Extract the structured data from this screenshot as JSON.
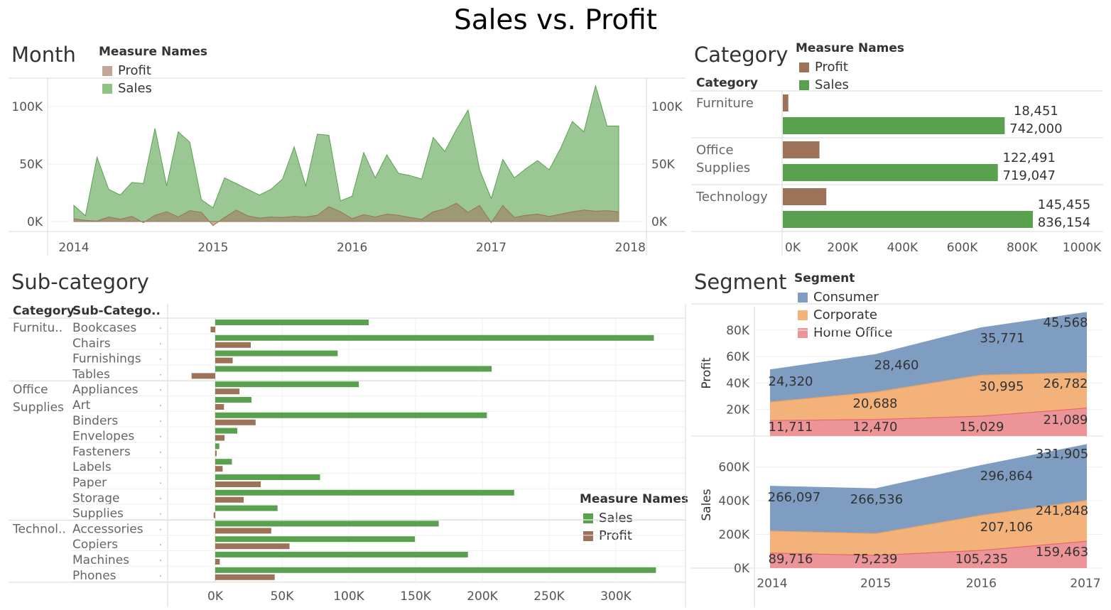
{
  "dashboard": {
    "title": "Sales vs. Profit"
  },
  "colors": {
    "sales": "#59A14F",
    "profit": "#9C7259",
    "consumer": "#7E9DC1",
    "corporate": "#F3B27A",
    "home_office": "#EC9497"
  },
  "month": {
    "title": "Month",
    "legend": {
      "title": "Measure Names",
      "items": [
        "Profit",
        "Sales"
      ]
    }
  },
  "category": {
    "title": "Category",
    "header": "Category",
    "legend": {
      "title": "Measure Names",
      "items": [
        "Profit",
        "Sales"
      ]
    }
  },
  "subcategory": {
    "title": "Sub-category",
    "headers": [
      "Category",
      "Sub-Catego.."
    ],
    "legend": {
      "title": "Measure Names",
      "items": [
        "Sales",
        "Profit"
      ]
    }
  },
  "segment": {
    "title": "Segment",
    "legend": {
      "title": "Segment",
      "items": [
        "Consumer",
        "Corporate",
        "Home Office"
      ]
    }
  },
  "chart_data": [
    {
      "id": "month",
      "type": "area",
      "x_ticks": [
        "2014",
        "2015",
        "2016",
        "2017",
        "2018"
      ],
      "y_ticks": [
        "100K",
        "50K",
        "0K"
      ],
      "ylim": [
        -5000,
        125000
      ],
      "x": [
        "2014-01",
        "2014-02",
        "2014-03",
        "2014-04",
        "2014-05",
        "2014-06",
        "2014-07",
        "2014-08",
        "2014-09",
        "2014-10",
        "2014-11",
        "2014-12",
        "2015-01",
        "2015-02",
        "2015-03",
        "2015-04",
        "2015-05",
        "2015-06",
        "2015-07",
        "2015-08",
        "2015-09",
        "2015-10",
        "2015-11",
        "2015-12",
        "2016-01",
        "2016-02",
        "2016-03",
        "2016-04",
        "2016-05",
        "2016-06",
        "2016-07",
        "2016-08",
        "2016-09",
        "2016-10",
        "2016-11",
        "2016-12",
        "2017-01",
        "2017-02",
        "2017-03",
        "2017-04",
        "2017-05",
        "2017-06",
        "2017-07",
        "2017-08",
        "2017-09",
        "2017-10",
        "2017-11",
        "2017-12"
      ],
      "series": [
        {
          "name": "Sales",
          "values": [
            14000,
            5000,
            56000,
            28000,
            23000,
            34000,
            33000,
            81000,
            31000,
            78000,
            69000,
            19000,
            12000,
            38000,
            33000,
            28000,
            23000,
            28000,
            37000,
            65000,
            31000,
            76000,
            75000,
            18000,
            22000,
            60000,
            38000,
            58000,
            42000,
            40000,
            37000,
            73000,
            61000,
            80000,
            97000,
            45000,
            20000,
            54000,
            38000,
            46000,
            53000,
            45000,
            64000,
            87000,
            78000,
            118000,
            83000,
            83000
          ]
        },
        {
          "name": "Profit",
          "values": [
            2500,
            1000,
            500,
            4000,
            2000,
            4500,
            -1000,
            5500,
            8500,
            4000,
            9500,
            8000,
            -3500,
            3500,
            10000,
            5000,
            3000,
            4000,
            3500,
            4500,
            4000,
            5500,
            13000,
            8500,
            2500,
            6000,
            4000,
            6500,
            5500,
            3500,
            2000,
            8500,
            11000,
            16000,
            8000,
            14000,
            -1000,
            14000,
            3500,
            5500,
            6500,
            4500,
            6500,
            8500,
            10000,
            9000,
            9500,
            8500
          ]
        }
      ]
    },
    {
      "id": "category",
      "type": "bar",
      "orientation": "horizontal",
      "categories": [
        "Furniture",
        "Office Supplies",
        "Technology"
      ],
      "category_lines": [
        [
          "Furniture"
        ],
        [
          "Office",
          "Supplies"
        ],
        [
          "Technology"
        ]
      ],
      "series": [
        {
          "name": "Profit",
          "values": [
            18451,
            122491,
            145455
          ],
          "labels": [
            "18,451",
            "122,491",
            "145,455"
          ]
        },
        {
          "name": "Sales",
          "values": [
            742000,
            719047,
            836154
          ],
          "labels": [
            "742,000",
            "719,047",
            "836,154"
          ]
        }
      ],
      "x_ticks": [
        "0K",
        "200K",
        "400K",
        "600K",
        "800K",
        "1000K"
      ],
      "xlim": [
        0,
        1000000
      ]
    },
    {
      "id": "subcategory",
      "type": "bar",
      "orientation": "horizontal",
      "groups": [
        {
          "label": "Furnitu..",
          "items": [
            "Bookcases",
            "Chairs",
            "Furnishings",
            "Tables"
          ]
        },
        {
          "label": "Office Supplies",
          "lines": [
            "Office",
            "Supplies"
          ],
          "items": [
            "Appliances",
            "Art",
            "Binders",
            "Envelopes",
            "Fasteners",
            "Labels",
            "Paper",
            "Storage",
            "Supplies"
          ]
        },
        {
          "label": "Technol..",
          "items": [
            "Accessories",
            "Copiers",
            "Machines",
            "Phones"
          ]
        }
      ],
      "categories": [
        "Bookcases",
        "Chairs",
        "Furnishings",
        "Tables",
        "Appliances",
        "Art",
        "Binders",
        "Envelopes",
        "Fasteners",
        "Labels",
        "Paper",
        "Storage",
        "Supplies",
        "Accessories",
        "Copiers",
        "Machines",
        "Phones"
      ],
      "series": [
        {
          "name": "Sales",
          "values": [
            114880,
            328449,
            91705,
            206966,
            107532,
            27119,
            203413,
            16476,
            3024,
            12486,
            78479,
            223844,
            46674,
            167380,
            149528,
            189239,
            330007
          ]
        },
        {
          "name": "Profit",
          "values": [
            -3473,
            26590,
            13059,
            -17725,
            18138,
            6528,
            30222,
            6964,
            950,
            5546,
            34054,
            21279,
            -1189,
            41937,
            55618,
            3385,
            44516
          ]
        }
      ],
      "x_ticks": [
        "0K",
        "50K",
        "100K",
        "150K",
        "200K",
        "250K",
        "300K"
      ],
      "xlim": [
        -35000,
        350000
      ]
    },
    {
      "id": "segment-profit",
      "type": "area",
      "stacked": true,
      "ylabel": "Profit",
      "x": [
        "2014",
        "2015",
        "2016",
        "2017"
      ],
      "series": [
        {
          "name": "Home Office",
          "values": [
            11711,
            12470,
            15029,
            21089
          ],
          "labels": [
            "11,711",
            "12,470",
            "15,029",
            "21,089"
          ]
        },
        {
          "name": "Corporate",
          "values": [
            13957,
            20688,
            30995,
            26782
          ],
          "labels": [
            "",
            "20,688",
            "30,995",
            "26,782"
          ]
        },
        {
          "name": "Consumer",
          "values": [
            24320,
            28460,
            35771,
            45568
          ],
          "labels": [
            "24,320",
            "28,460",
            "35,771",
            "45,568"
          ]
        }
      ],
      "y_ticks": [
        "80K",
        "60K",
        "40K",
        "20K"
      ],
      "ylim": [
        0,
        95000
      ]
    },
    {
      "id": "segment-sales",
      "type": "area",
      "stacked": true,
      "ylabel": "Sales",
      "x": [
        "2014",
        "2015",
        "2016",
        "2017"
      ],
      "series": [
        {
          "name": "Home Office",
          "values": [
            89716,
            75239,
            105235,
            159463
          ],
          "labels": [
            "89,716",
            "75,239",
            "105,235",
            "159,463"
          ]
        },
        {
          "name": "Corporate",
          "values": [
            130000,
            129000,
            207106,
            241848
          ],
          "labels": [
            "",
            "",
            "207,106",
            "241,848"
          ]
        },
        {
          "name": "Consumer",
          "values": [
            266097,
            266536,
            296864,
            331905
          ],
          "labels": [
            "266,097",
            "266,536",
            "296,864",
            "331,905"
          ]
        }
      ],
      "y_ticks": [
        "600K",
        "400K",
        "200K",
        "0K"
      ],
      "x_ticks": [
        "2014",
        "2015",
        "2016",
        "2017"
      ],
      "ylim": [
        0,
        750000
      ]
    }
  ]
}
